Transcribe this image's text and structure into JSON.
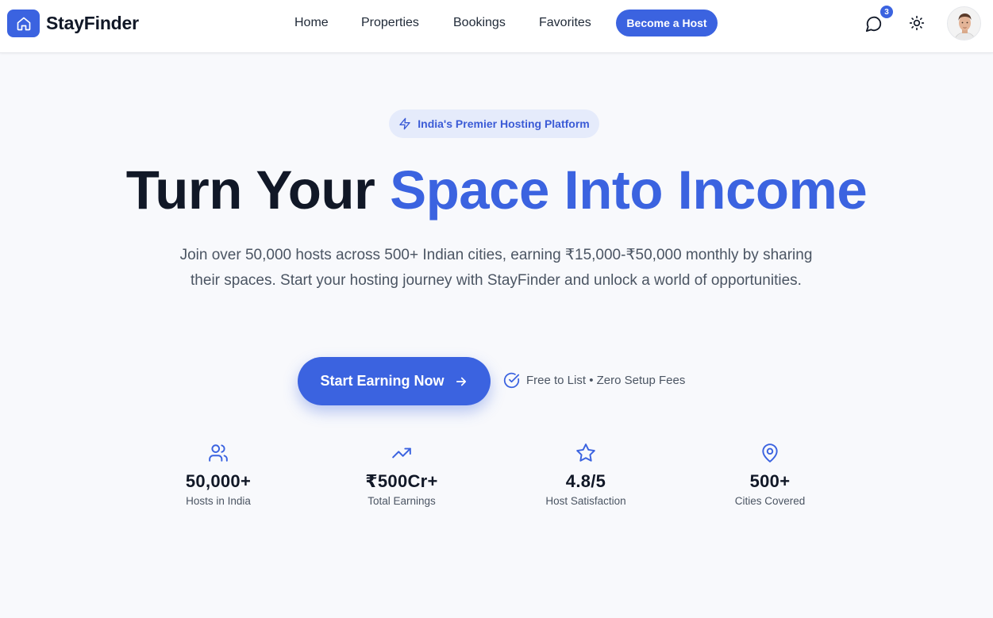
{
  "header": {
    "brand": "StayFinder",
    "nav": [
      "Home",
      "Properties",
      "Bookings",
      "Favorites"
    ],
    "host_button": "Become a Host",
    "messages_badge": "3",
    "icons": {
      "logo": "home-icon",
      "messages": "message-circle-icon",
      "theme": "sun-icon",
      "avatar": "user-avatar"
    }
  },
  "hero": {
    "pill": "India's Premier Hosting Platform",
    "headline_dark": "Turn Your ",
    "headline_accent": "Space Into Income",
    "subtext": "Join over 50,000 hosts across 500+ Indian cities, earning ₹15,000-₹50,000 monthly by sharing their spaces. Start your hosting journey with StayFinder and unlock a world of opportunities.",
    "cta": "Start Earning Now",
    "free_note": "Free to List • Zero Setup Fees"
  },
  "stats": [
    {
      "icon": "users-icon",
      "value": "50,000+",
      "label": "Hosts in India"
    },
    {
      "icon": "trending-up-icon",
      "value": "₹500Cr+",
      "label": "Total Earnings"
    },
    {
      "icon": "star-icon",
      "value": "4.8/5",
      "label": "Host Satisfaction"
    },
    {
      "icon": "map-pin-icon",
      "value": "500+",
      "label": "Cities Covered"
    }
  ],
  "colors": {
    "accent": "#3b63e0",
    "background": "#f8f9fc",
    "text_dark": "#111827",
    "text_muted": "#4b5563"
  }
}
